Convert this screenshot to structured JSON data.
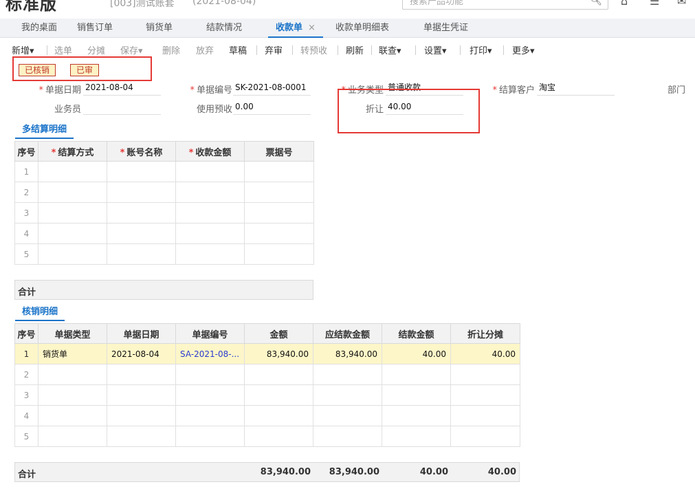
{
  "header": {
    "logo": "标准版",
    "account": "[003]测试账套",
    "date": "(2021-08-04)",
    "search_placeholder": "搜索产品功能"
  },
  "tabs": [
    {
      "label": "我的桌面"
    },
    {
      "label": "销售订单"
    },
    {
      "label": "销货单"
    },
    {
      "label": "结款情况"
    },
    {
      "label": "收款单",
      "active": true,
      "close": "×"
    },
    {
      "label": "收款单明细表"
    },
    {
      "label": "单据生凭证"
    }
  ],
  "toolbar": {
    "new": "新增",
    "select": "选单",
    "split": "分摊",
    "save": "保存",
    "delete": "删除",
    "abandon": "放弃",
    "draft": "草稿",
    "unaudit": "弃审",
    "to_prepay": "转预收",
    "refresh": "刷新",
    "linked_query": "联查",
    "settings": "设置",
    "print": "打印",
    "more": "更多",
    "caret": "▾"
  },
  "status": {
    "written_off": "已核销",
    "audited": "已审"
  },
  "form": {
    "req_mark": "*",
    "doc_date_label": "单据日期",
    "doc_date": "2021-08-04",
    "doc_no_label": "单据编号",
    "doc_no": "SK-2021-08-0001",
    "biz_type_label": "业务类型",
    "biz_type": "普通收款",
    "customer_label": "结算客户",
    "customer": "淘宝",
    "dept_label": "部门",
    "salesman_label": "业务员",
    "salesman": "",
    "use_prepay_label": "使用预收",
    "use_prepay": "0.00",
    "discount_label": "折让",
    "discount": "40.00"
  },
  "settlement": {
    "title": "多结算明细",
    "headers": [
      "序号",
      "结算方式",
      "账号名称",
      "收款金额",
      "票据号"
    ],
    "required": [
      false,
      true,
      true,
      true,
      false
    ],
    "rows": [
      "1",
      "2",
      "3",
      "4",
      "5"
    ],
    "total_label": "合计"
  },
  "writeoff": {
    "title": "核销明细",
    "headers": [
      "序号",
      "单据类型",
      "单据日期",
      "单据编号",
      "金额",
      "应结款金额",
      "结款金额",
      "折让分摊"
    ],
    "rows": [
      [
        "1",
        "销货单",
        "2021-08-04",
        "SA-2021-08-...",
        "83,940.00",
        "83,940.00",
        "40.00",
        "40.00"
      ],
      [
        "2",
        "",
        "",
        "",
        "",
        "",
        "",
        ""
      ],
      [
        "3",
        "",
        "",
        "",
        "",
        "",
        "",
        ""
      ],
      [
        "4",
        "",
        "",
        "",
        "",
        "",
        "",
        ""
      ],
      [
        "5",
        "",
        "",
        "",
        "",
        "",
        "",
        ""
      ]
    ],
    "total": {
      "label": "合计",
      "amount": "83,940.00",
      "due": "83,940.00",
      "settled": "40.00",
      "discount_alloc": "40.00"
    }
  }
}
